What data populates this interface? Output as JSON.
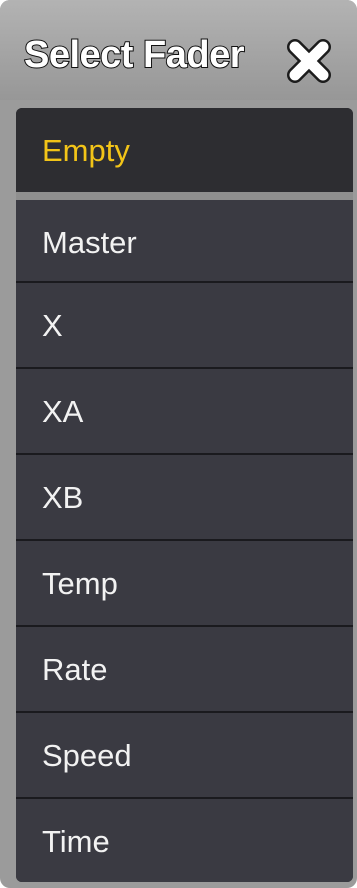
{
  "dialog": {
    "title": "Select Fader",
    "close_icon": "close-x-icon"
  },
  "list": {
    "selected": "Empty",
    "items": [
      {
        "label": "Empty"
      },
      {
        "label": "Master"
      },
      {
        "label": "X"
      },
      {
        "label": "XA"
      },
      {
        "label": "XB"
      },
      {
        "label": "Temp"
      },
      {
        "label": "Rate"
      },
      {
        "label": "Speed"
      },
      {
        "label": "Time"
      }
    ]
  },
  "colors": {
    "selected_text": "#f2c418",
    "item_background": "#3a3a42",
    "frame": "#9b9b9b"
  }
}
